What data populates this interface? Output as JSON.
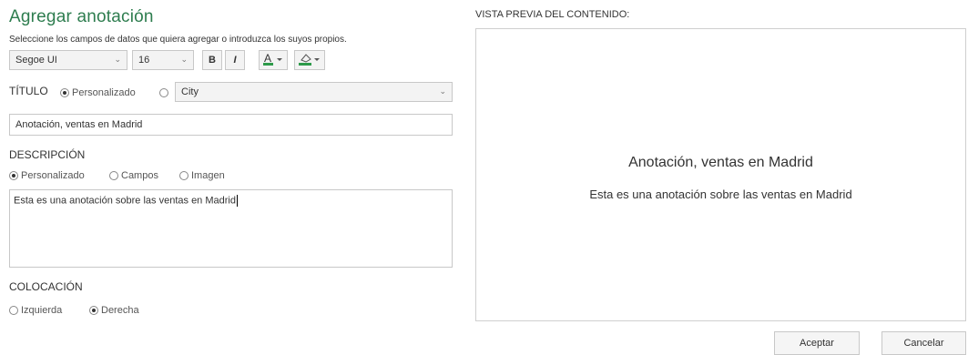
{
  "dialog": {
    "title": "Agregar anotación",
    "subtitle": "Seleccione los campos de datos que quiera agregar o introduzca los suyos propios."
  },
  "toolbar": {
    "font_family": "Segoe UI",
    "font_size": "16",
    "bold_label": "B",
    "italic_label": "I",
    "font_color_icon": "font-color-icon",
    "fill_color_icon": "fill-color-icon",
    "accent_color": "#2e9a4a"
  },
  "titulo": {
    "label": "TÍTULO",
    "option_custom": "Personalizado",
    "field_select": "City",
    "value": "Anotación, ventas en Madrid"
  },
  "descripcion": {
    "label": "DESCRIPCIÓN",
    "option_custom": "Personalizado",
    "option_fields": "Campos",
    "option_image": "Imagen",
    "value": "Esta es una anotación sobre las ventas en Madrid"
  },
  "colocacion": {
    "label": "COLOCACIÓN",
    "option_left": "Izquierda",
    "option_right": "Derecha"
  },
  "preview": {
    "heading": "VISTA PREVIA DEL CONTENIDO:",
    "title": "Anotación, ventas en Madrid",
    "description": "Esta es una anotación sobre las ventas en Madrid"
  },
  "footer": {
    "accept_label": "Aceptar",
    "cancel_label": "Cancelar"
  }
}
